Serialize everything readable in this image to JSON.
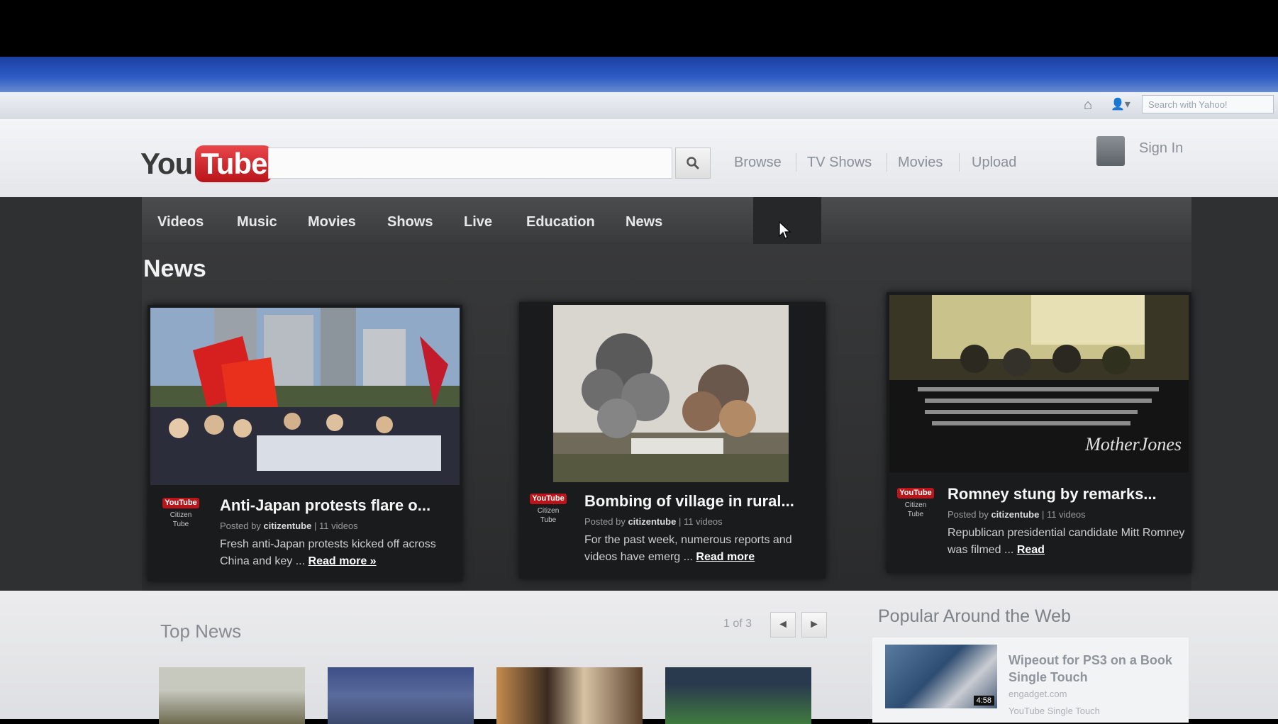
{
  "browser": {
    "search_placeholder": "Search with Yahoo!"
  },
  "header": {
    "logo_you": "You",
    "logo_tube": "Tube",
    "search_value": "",
    "links": [
      "Browse",
      "TV Shows",
      "Movies",
      "Upload"
    ],
    "sign_in": "Sign In"
  },
  "categories": {
    "tabs": [
      "Videos",
      "Music",
      "Movies",
      "Shows",
      "Live",
      "Education",
      "News"
    ],
    "active": "News"
  },
  "main": {
    "section_title": "News",
    "cards": [
      {
        "title": "Anti-Japan protests flare o...",
        "meta_prefix": "Posted by",
        "channel": "citizentube",
        "meta_suffix": "| 11 videos",
        "desc": "Fresh anti-Japan protests kicked off across China and key ...",
        "read_more": "Read more »",
        "logo_line1": "YouTube",
        "logo_line2": "Citizen",
        "logo_line3": "Tube"
      },
      {
        "title": "Bombing of village in rural...",
        "meta_prefix": "Posted by",
        "channel": "citizentube",
        "meta_suffix": "| 11 videos",
        "desc": "For the past week, numerous reports and videos have emerg ...",
        "read_more": "Read more",
        "logo_line1": "YouTube",
        "logo_line2": "Citizen",
        "logo_line3": "Tube"
      },
      {
        "title": "Romney stung by remarks...",
        "meta_prefix": "Posted by",
        "channel": "citizentube",
        "meta_suffix": "| 11 videos",
        "desc": "Republican presidential candidate Mitt Romney was filmed ...",
        "read_more": "Read",
        "logo_line1": "YouTube",
        "logo_line2": "Citizen",
        "logo_line3": "Tube",
        "watermark": "MotherJones"
      }
    ]
  },
  "bottom": {
    "top_news_label": "Top News",
    "pager_text": "1 of 3",
    "prev": "◄",
    "next": "►",
    "popular_label": "Popular Around the Web",
    "popular_item": {
      "title": "Wipeout for PS3 on a Book Single Touch",
      "source": "engadget.com",
      "subline": "YouTube Single Touch",
      "duration": "4:58"
    }
  },
  "colors": {
    "title_bar": "#2d5cc4",
    "logo_red": "#c4161c",
    "dark_bg": "#333435"
  }
}
